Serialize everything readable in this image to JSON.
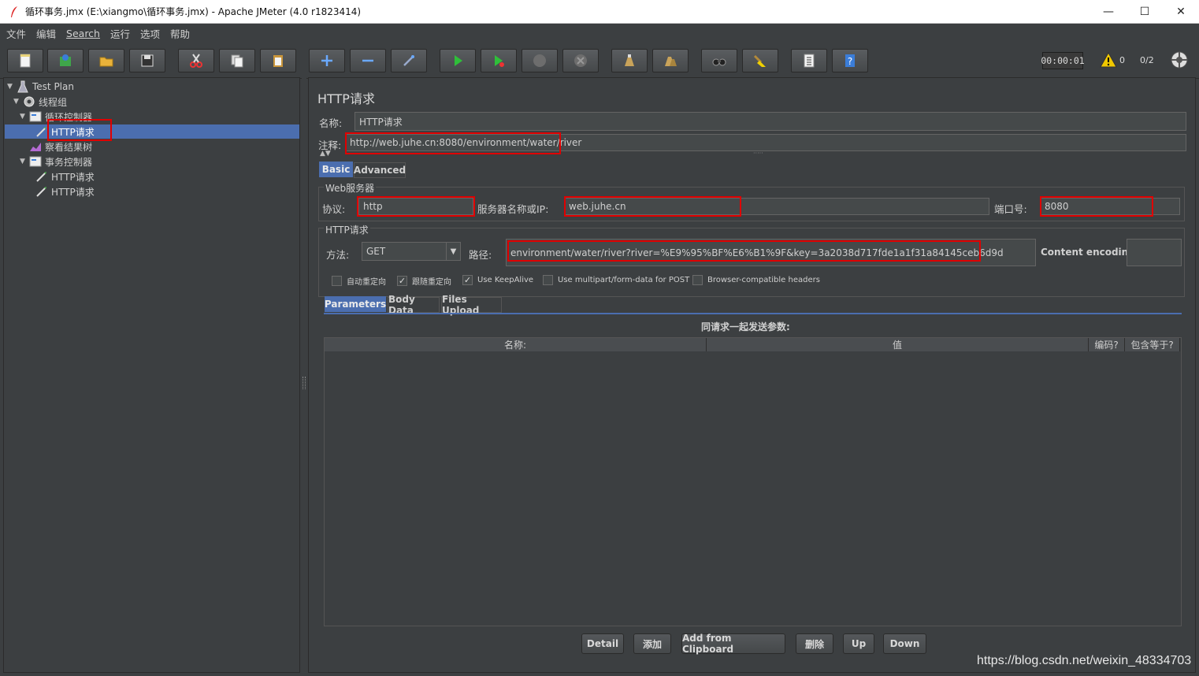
{
  "window": {
    "title": "循环事务.jmx (E:\\xiangmo\\循环事务.jmx) - Apache JMeter (4.0 r1823414)",
    "minimize": "—",
    "maximize": "☐",
    "close": "✕"
  },
  "menu": [
    "文件",
    "编辑",
    "Search",
    "运行",
    "选项",
    "帮助"
  ],
  "toolbar": {
    "buttons": [
      "new-icon",
      "templates-icon",
      "open-icon",
      "save-icon",
      "cut-icon",
      "copy-icon",
      "paste-icon",
      "expand-icon",
      "collapse-icon",
      "toggle-icon",
      "start-icon",
      "start-no-pause-icon",
      "stop-icon",
      "shutdown-icon",
      "clear-icon",
      "clear-all-icon",
      "search-icon",
      "reset-search-icon",
      "function-helper-icon",
      "help-icon"
    ],
    "timer": "00:00:01",
    "warnings": "0",
    "threads": "0/2"
  },
  "tree": [
    {
      "label": "Test Plan",
      "icon": "test-plan-icon",
      "expanded": true
    },
    {
      "label": "线程组",
      "icon": "thread-group-icon",
      "expanded": true
    },
    {
      "label": "循环控制器",
      "icon": "controller-icon",
      "expanded": true
    },
    {
      "label": "HTTP请求",
      "icon": "sampler-icon",
      "selected": true
    },
    {
      "label": "察看结果树",
      "icon": "listener-icon"
    },
    {
      "label": "事务控制器",
      "icon": "controller-icon",
      "expanded": true
    },
    {
      "label": "HTTP请求",
      "icon": "sampler-icon"
    },
    {
      "label": "HTTP请求",
      "icon": "sampler-icon"
    }
  ],
  "panel": {
    "title": "HTTP请求",
    "name_label": "名称:",
    "name_value": "HTTP请求",
    "comment_label": "注释:",
    "comment_value": "http://web.juhe.cn:8080/environment/water/river",
    "tabs": [
      "Basic",
      "Advanced"
    ],
    "web_server_title": "Web服务器",
    "protocol_label": "协议:",
    "protocol_value": "http",
    "server_label": "服务器名称或IP:",
    "server_value": "web.juhe.cn",
    "port_label": "端口号:",
    "port_value": "8080",
    "http_request_title": "HTTP请求",
    "method_label": "方法:",
    "method_value": "GET",
    "path_label": "路径:",
    "path_value": "environment/water/river?river=%E9%95%BF%E6%B1%9F&key=3a2038d717fde1a1f31a84145ceb6d9d",
    "encoding_label": "Content encoding:",
    "encoding_value": "",
    "checkboxes": [
      {
        "label": "自动重定向",
        "checked": false
      },
      {
        "label": "跟随重定向",
        "checked": true
      },
      {
        "label": "Use KeepAlive",
        "checked": true
      },
      {
        "label": "Use multipart/form-data for POST",
        "checked": false
      },
      {
        "label": "Browser-compatible headers",
        "checked": false
      }
    ],
    "param_tabs": [
      "Parameters",
      "Body Data",
      "Files Upload"
    ],
    "params_caption": "同请求一起发送参数:",
    "columns": [
      "名称:",
      "值",
      "编码?",
      "包含等于?"
    ],
    "buttons": [
      "Detail",
      "添加",
      "Add from Clipboard",
      "删除",
      "Up",
      "Down"
    ]
  },
  "watermark": "https://blog.csdn.net/weixin_48334703",
  "colors": {
    "highlight": "#e00000",
    "selection": "#4b6eaf",
    "background": "#3c3f41"
  }
}
